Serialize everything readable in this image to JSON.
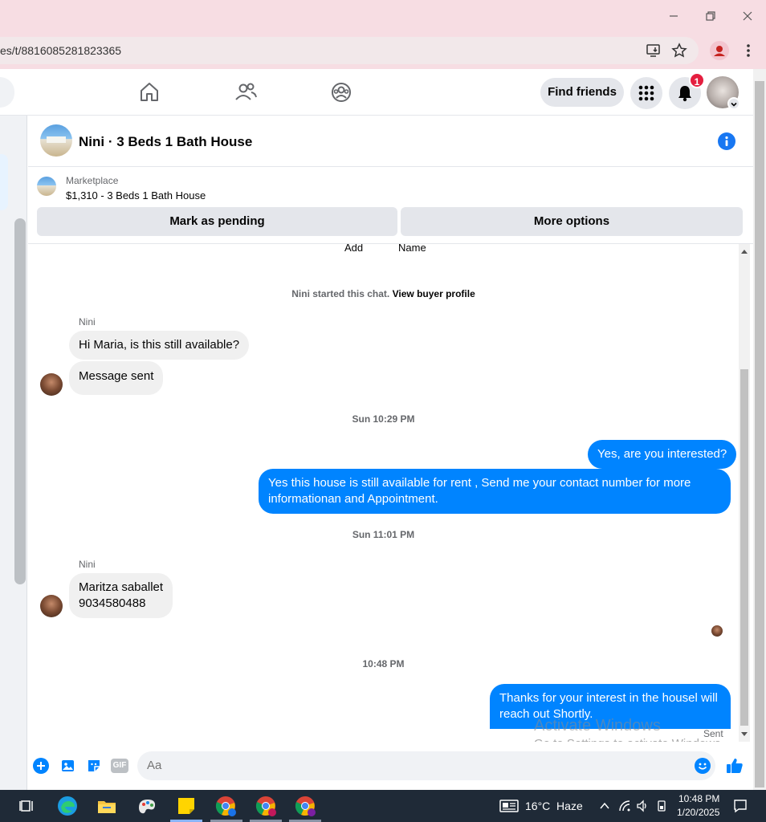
{
  "browser": {
    "url": "es/t/8816085281823365",
    "window_controls": [
      "minimize",
      "restore",
      "close"
    ]
  },
  "fb_nav": {
    "find_friends_label": "Find friends",
    "notification_count": "1"
  },
  "chat": {
    "title": "Nini · 3 Beds 1 Bath House",
    "marketplace_label": "Marketplace",
    "listing": "$1,310 - 3 Beds 1 Bath House",
    "mark_pending_label": "Mark as pending",
    "more_options_label": "More options",
    "top_cut_labels": [
      "Add",
      "Name"
    ],
    "started_text": "Nini started this chat.",
    "view_profile_link": "View buyer profile",
    "messages": [
      {
        "sender": "Nini",
        "text": "Hi Maria, is this still available?"
      },
      {
        "text": "Message sent"
      },
      {
        "timestamp": "Sun 10:29 PM"
      },
      {
        "text": "Yes, are you interested?"
      },
      {
        "text": "Yes this house is still available for rent , Send me your contact number for more informationan and Appointment."
      },
      {
        "timestamp": "Sun 11:01 PM"
      },
      {
        "sender": "Nini",
        "text": "Maritza saballet\n9034580488"
      },
      {
        "timestamp": "10:48 PM"
      },
      {
        "text": "Thanks for your interest in the housel will reach out Shortly."
      }
    ],
    "sent_status": "Sent",
    "composer_placeholder": "Aa"
  },
  "watermark": {
    "line1": "Activate Windows",
    "line2": "Go to Settings to activate Windows."
  },
  "taskbar": {
    "weather": "16°C  Haze",
    "time": "10:48 PM",
    "date": "1/20/2025"
  },
  "colors": {
    "accent": "#0084ff",
    "fb_blue": "#1877f2",
    "titlebar": "#f7dde3",
    "taskbar": "#1f2a37"
  }
}
